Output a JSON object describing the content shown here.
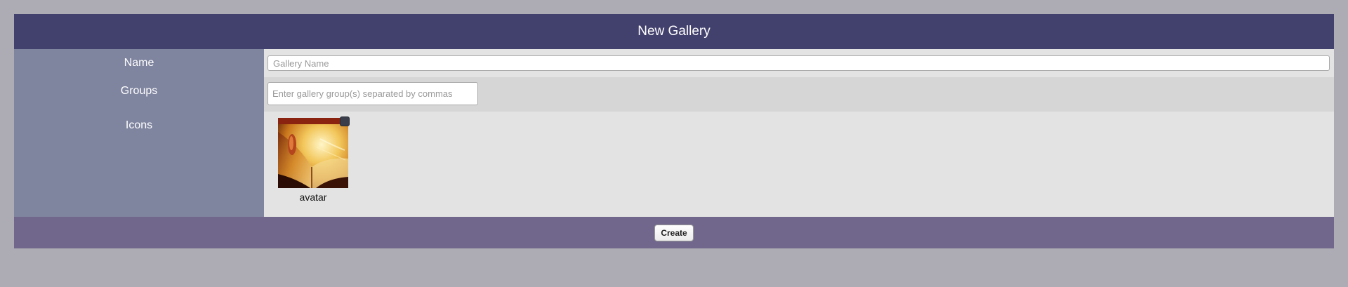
{
  "form": {
    "title": "New Gallery",
    "name": {
      "label": "Name",
      "value": "",
      "placeholder": "Gallery Name"
    },
    "groups": {
      "label": "Groups",
      "value": "",
      "placeholder": "Enter gallery group(s) separated by commas"
    },
    "icons": {
      "label": "Icons",
      "items": [
        {
          "caption": "avatar",
          "selected": true
        }
      ]
    },
    "submit_label": "Create"
  },
  "colors": {
    "page_background": "#adacb4",
    "header": "#42406d",
    "label_column": "#7f849f",
    "footer": "#71678c"
  }
}
